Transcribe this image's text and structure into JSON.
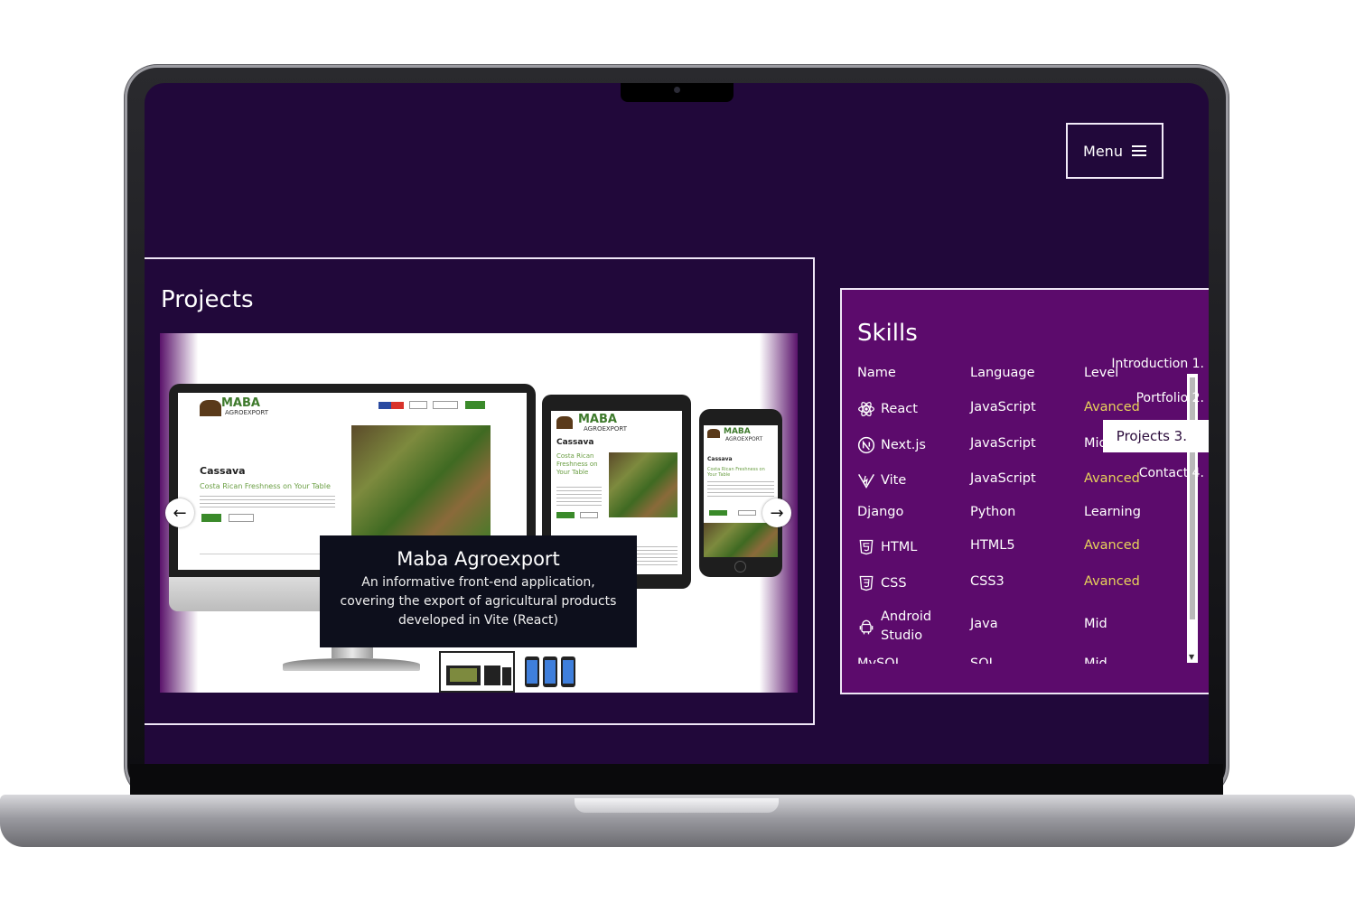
{
  "header": {
    "menu_label": "Menu",
    "menu_icon": "hamburger-icon"
  },
  "projects": {
    "title": "Projects",
    "slide": {
      "logo": "MABA",
      "logo_sub": "AGROEXPORT",
      "heading": "Cassava",
      "tagline": "Costa Rican Freshness on Your Table",
      "tablet_tagline": "Costa Rican Freshness on Your Table"
    },
    "caption": {
      "title": "Maba Agroexport",
      "description": "An informative front-end application, covering the export of agricultural products developed in Vite (React)"
    },
    "prev_icon": "arrow-left-icon",
    "next_icon": "arrow-right-icon",
    "prev_glyph": "←",
    "next_glyph": "→",
    "thumbnails": 2,
    "selected_thumbnail": 1
  },
  "skills": {
    "title": "Skills",
    "headers": {
      "name": "Name",
      "language": "Language",
      "level": "Level"
    },
    "rows": [
      {
        "name": "React",
        "language": "JavaScript",
        "level": "Avanced",
        "icon": "react-icon",
        "highlight": true
      },
      {
        "name": "Next.js",
        "language": "JavaScript",
        "level": "Mid",
        "icon": "nextjs-icon",
        "highlight": false
      },
      {
        "name": "Vite",
        "language": "JavaScript",
        "level": "Avanced",
        "icon": "vite-icon",
        "highlight": true
      },
      {
        "name": "Django",
        "language": "Python",
        "level": "Learning",
        "icon": "",
        "highlight": false
      },
      {
        "name": "HTML",
        "language": "HTML5",
        "level": "Avanced",
        "icon": "html5-icon",
        "highlight": true
      },
      {
        "name": "CSS",
        "language": "CSS3",
        "level": "Avanced",
        "icon": "css3-icon",
        "highlight": true
      },
      {
        "name": "Android Studio",
        "language": "Java",
        "level": "Mid",
        "icon": "android-icon",
        "highlight": false
      },
      {
        "name": "MySQL",
        "language": "SQL",
        "level": "Mid",
        "icon": "",
        "highlight": false
      }
    ],
    "highlight_color": "#e8d35a"
  },
  "sidenav": {
    "items": [
      {
        "label": "Introduction 1.",
        "active": false
      },
      {
        "label": "Portfolio 2.",
        "active": false
      },
      {
        "label": "Projects 3.",
        "active": true
      },
      {
        "label": "Contact 4.",
        "active": false
      }
    ]
  },
  "colors": {
    "background": "#21083a",
    "skills_panel": "#5c0b6c",
    "accent": "#e8d35a"
  }
}
